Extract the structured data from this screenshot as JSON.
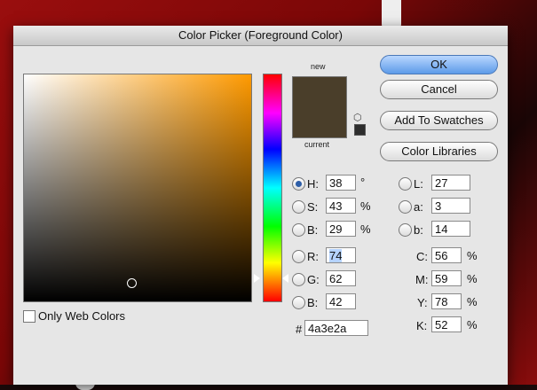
{
  "window": {
    "title": "Color Picker (Foreground Color)"
  },
  "preview": {
    "new_label": "new",
    "current_label": "current",
    "swatch_color": "#4a3e2a"
  },
  "buttons": {
    "ok": "OK",
    "cancel": "Cancel",
    "add_to_swatches": "Add To Swatches",
    "color_libraries": "Color Libraries"
  },
  "hsb": {
    "h": {
      "label": "H:",
      "value": "38",
      "unit": "°"
    },
    "s": {
      "label": "S:",
      "value": "43",
      "unit": "%"
    },
    "b": {
      "label": "B:",
      "value": "29",
      "unit": "%"
    }
  },
  "rgb": {
    "r": {
      "label": "R:",
      "value": "74"
    },
    "g": {
      "label": "G:",
      "value": "62"
    },
    "b": {
      "label": "B:",
      "value": "42"
    }
  },
  "lab": {
    "l": {
      "label": "L:",
      "value": "27"
    },
    "a": {
      "label": "a:",
      "value": "3"
    },
    "b": {
      "label": "b:",
      "value": "14"
    }
  },
  "cmyk": {
    "c": {
      "label": "C:",
      "value": "56",
      "unit": "%"
    },
    "m": {
      "label": "M:",
      "value": "59",
      "unit": "%"
    },
    "y": {
      "label": "Y:",
      "value": "78",
      "unit": "%"
    },
    "k": {
      "label": "K:",
      "value": "52",
      "unit": "%"
    }
  },
  "hex": {
    "label": "#",
    "value": "4a3e2a"
  },
  "options": {
    "only_web_colors": "Only Web Colors"
  },
  "icons": {
    "gamut_cube": "cube-icon"
  }
}
